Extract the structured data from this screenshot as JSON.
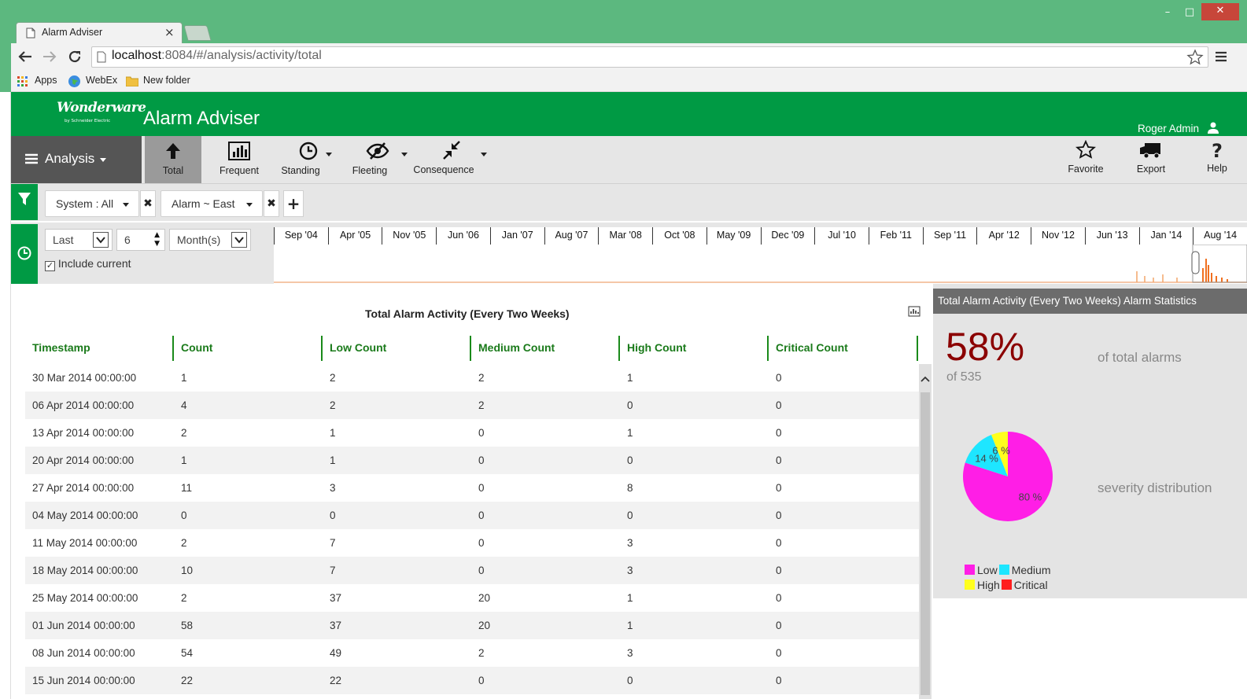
{
  "window": {
    "minimize": "–",
    "maximize": "□",
    "close": "✕"
  },
  "browser": {
    "tab_title": "Alarm Adviser",
    "tab_close": "×",
    "url_host": "localhost",
    "url_rest": ":8084/#/analysis/activity/total",
    "bookmarks": [
      {
        "label": "Apps"
      },
      {
        "label": "WebEx"
      },
      {
        "label": "New folder"
      }
    ]
  },
  "app": {
    "logo_text": "Wonderware",
    "logo_sub": "by Schneider Electric",
    "title": "Alarm Adviser",
    "user": "Roger Admin"
  },
  "toolbar": {
    "analysis_label": "Analysis",
    "buttons": [
      {
        "label": "Total",
        "icon": "arrow-up-icon",
        "active": true
      },
      {
        "label": "Frequent",
        "icon": "bar-chart-icon"
      },
      {
        "label": "Standing",
        "icon": "clock-icon"
      },
      {
        "label": "Fleeting",
        "icon": "eye-slash-icon"
      },
      {
        "label": "Consequence",
        "icon": "compress-icon"
      }
    ],
    "right_buttons": [
      {
        "label": "Favorite",
        "icon": "star-icon"
      },
      {
        "label": "Export",
        "icon": "truck-icon"
      },
      {
        "label": "Help",
        "icon": "question-icon"
      }
    ]
  },
  "filters": {
    "system": "System : All",
    "alarm": "Alarm ~ East",
    "remove": "✖",
    "add": "+"
  },
  "time": {
    "mode": "Last",
    "amount": "6",
    "unit": "Month(s)",
    "include_current_label": "Include current",
    "include_current": true,
    "months": [
      "Sep '04",
      "Apr '05",
      "Nov '05",
      "Jun '06",
      "Jan '07",
      "Aug '07",
      "Mar '08",
      "Oct '08",
      "May '09",
      "Dec '09",
      "Jul '10",
      "Feb '11",
      "Sep '11",
      "Apr '12",
      "Nov '12",
      "Jun '13",
      "Jan '14",
      "Aug '14"
    ]
  },
  "grid": {
    "title": "Total Alarm Activity (Every Two Weeks)",
    "columns": [
      "Timestamp",
      "Count",
      "Low Count",
      "Medium Count",
      "High Count",
      "Critical Count"
    ],
    "rows": [
      [
        "30 Mar 2014 00:00:00",
        "1",
        "2",
        "2",
        "1",
        "0"
      ],
      [
        "06 Apr 2014 00:00:00",
        "4",
        "2",
        "2",
        "0",
        "0"
      ],
      [
        "13 Apr 2014 00:00:00",
        "2",
        "1",
        "0",
        "1",
        "0"
      ],
      [
        "20 Apr 2014 00:00:00",
        "1",
        "1",
        "0",
        "0",
        "0"
      ],
      [
        "27 Apr 2014 00:00:00",
        "11",
        "3",
        "0",
        "8",
        "0"
      ],
      [
        "04 May 2014 00:00:00",
        "0",
        "0",
        "0",
        "0",
        "0"
      ],
      [
        "11 May 2014 00:00:00",
        "2",
        "7",
        "0",
        "3",
        "0"
      ],
      [
        "18 May 2014 00:00:00",
        "10",
        "7",
        "0",
        "3",
        "0"
      ],
      [
        "25 May 2014 00:00:00",
        "2",
        "37",
        "20",
        "1",
        "0"
      ],
      [
        "01 Jun 2014 00:00:00",
        "58",
        "37",
        "20",
        "1",
        "0"
      ],
      [
        "08 Jun 2014 00:00:00",
        "54",
        "49",
        "2",
        "3",
        "0"
      ],
      [
        "15 Jun 2014 00:00:00",
        "22",
        "22",
        "0",
        "0",
        "0"
      ]
    ]
  },
  "stats": {
    "title": "Total Alarm Activity (Every Two Weeks) Alarm Statistics",
    "percent": "58%",
    "of_label": "of 535",
    "of_total": "of total alarms",
    "severity_label": "severity distribution",
    "pie": [
      {
        "label": "Low",
        "value": 80,
        "text": "80 %",
        "color": "#ff1ee6"
      },
      {
        "label": "Medium",
        "value": 14,
        "text": "14 %",
        "color": "#1ee6ff"
      },
      {
        "label": "High",
        "value": 6,
        "text": "6 %",
        "color": "#ffff1e"
      },
      {
        "label": "Critical",
        "value": 0,
        "text": "",
        "color": "#ff1e1e"
      }
    ]
  },
  "colors": {
    "brand": "#009a44",
    "chrome": "#5cb87f",
    "header_text": "#1a7a1a",
    "percent": "#8b0000"
  }
}
